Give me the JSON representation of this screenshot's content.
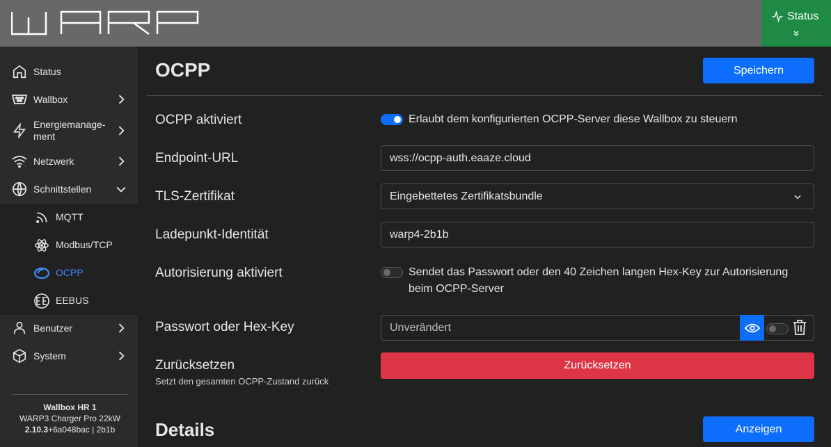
{
  "header": {
    "logo_text": "WARP",
    "status_label": "Status"
  },
  "sidebar": {
    "items": [
      {
        "label": "Status",
        "icon": "home-icon"
      },
      {
        "label": "Wallbox",
        "icon": "plug-icon"
      },
      {
        "label": "Energiemanage-",
        "label2": "ment",
        "icon": "bolt-icon"
      },
      {
        "label": "Netzwerk",
        "icon": "wifi-icon"
      },
      {
        "label": "Schnittstellen",
        "icon": "globe-icon"
      },
      {
        "label": "Benutzer",
        "icon": "user-icon"
      },
      {
        "label": "System",
        "icon": "box-icon"
      }
    ],
    "subitems": [
      {
        "label": "MQTT",
        "icon": "rss-icon"
      },
      {
        "label": "Modbus/TCP",
        "icon": "atom-icon"
      },
      {
        "label": "OCPP",
        "icon": "ocpp-icon"
      },
      {
        "label": "EEBUS",
        "icon": "eebus-icon"
      }
    ],
    "footer": {
      "name": "Wallbox HR 1",
      "model": "WARP3 Charger Pro 22kW",
      "version_bold": "2.10.3",
      "version_rest": "+6a048bac | 2b1b"
    }
  },
  "main": {
    "title": "OCPP",
    "save_label": "Speichern",
    "rows": {
      "enabled_label": "OCPP aktiviert",
      "enabled_text": "Erlaubt dem konfigurierten OCPP-Server diese Wallbox zu steuern",
      "enabled_state": true,
      "endpoint_label": "Endpoint-URL",
      "endpoint_value": "wss://ocpp-auth.eaaze.cloud",
      "tls_label": "TLS-Zertifikat",
      "tls_value": "Eingebettetes Zertifikatsbundle",
      "identity_label": "Ladepunkt-Identität",
      "identity_value": "warp4-2b1b",
      "auth_label": "Autorisierung aktiviert",
      "auth_text": "Sendet das Passwort oder den 40 Zeichen langen Hex-Key zur Autorisierung beim OCPP-Server",
      "auth_state": false,
      "password_label": "Passwort oder Hex-Key",
      "password_placeholder": "Unverändert",
      "reset_label": "Zurücksetzen",
      "reset_sub": "Setzt den gesamten OCPP-Zustand zurück",
      "reset_button": "Zurücksetzen"
    },
    "details_title": "Details",
    "details_button": "Anzeigen"
  },
  "colors": {
    "primary": "#0d6efd",
    "danger": "#dc3545",
    "status_green": "#1e8a45",
    "header_gray": "#686868"
  }
}
